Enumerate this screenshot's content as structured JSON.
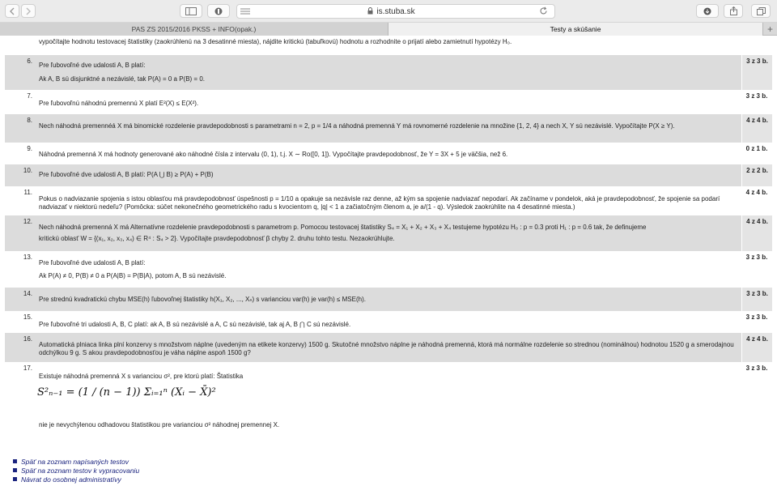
{
  "browser": {
    "url": "is.stuba.sk",
    "tabs": [
      "PAS ZS 2015/2016 PKSS + INFO(opak.)",
      "Testy a skúšanie"
    ]
  },
  "intro_text": "vypočítajte hodnotu testovacej štatistiky (zaokrúhlenú na 3 desatinné miesta), nájdite kritickú (tabuľkovú) hodnotu a rozhodnite o prijatí alebo zamietnutí hypotézy H₀.",
  "questions": [
    {
      "num": "6.",
      "score": "3 z 3 b.",
      "line1": "Pre ľubovoľné dve udalosti  A, B  platí:",
      "line2": "Ak A, B  sú disjunktné a nezávislé, tak  P(A) = 0  a  P(B) = 0."
    },
    {
      "num": "7.",
      "score": "3 z 3 b.",
      "line1": "Pre ľubovoľnú náhodnú premennú  X  platí  E²(X)  ≤  E(X²)."
    },
    {
      "num": "8.",
      "score": "4 z 4 b.",
      "line1": "Nech náhodná premennéá  X  má binomické rozdelenie pravdepodobnosti s parametrami  n = 2, p = 1/4  a  náhodná premenná  Y  má rovnomerné rozdelenie na množine  {1, 2, 4}  a nech  X, Y  sú nezávislé. Vypočítajte P(X ≥ Y)."
    },
    {
      "num": "9.",
      "score": "0 z 1 b.",
      "line1": "Náhodná premenná  X  má hodnoty generované ako náhodné čísla z intervalu  (0, 1), t.j.  X ∼ Ro([0,  1]). Vypočítajte pravdepodobnosť, že  Y = 3X + 5  je väčšia, než  6."
    },
    {
      "num": "10.",
      "score": "2 z 2 b.",
      "line1": "Pre ľubovoľné dve udalosti  A, B  platí:  P(A ⋃ B) ≥ P(A) + P(B)"
    },
    {
      "num": "11.",
      "score": "4 z 4 b.",
      "line1": "Pokus o nadviazanie spojenia s istou oblasťou má pravdepodobnosť úspešnosti  p = 1/10  a opakuje sa nezávisle raz denne, až kým sa spojenie nadviazať nepodarí. Ak začíname v pondelok, aká je pravdepodobnosť, že spojenie sa podarí nadviazať v niektorú nedeľu? (Pomôcka: súčet nekonečného geometrického radu s kvocientom  q, |q| < 1  a začiatočným členom  a, je  a/(1 - q). Výsledok zaokrúhlite na  4  desatinné miesta.)"
    },
    {
      "num": "12.",
      "score": "4 z 4 b.",
      "line1": "Nech náhodná premenná  X  má Alternatívne rozdelenie pravdepodobnosti s parametrom  p. Pomocou testovacej štatistiky  S₄  = X₁ + X₂ + X₃ + X₄  testujeme hypotézu  H₀ : p = 0.3  proti  H₁ : p = 0.6  tak, že definujeme",
      "line2": "kritickú oblasť  W = {(x₁, x₂, x₃, x₄) ∈ R⁴ : S₄ > 2}. Vypočítajte pravdepodobnosť  β  chyby 2. druhu tohto testu. Nezaokrúhlujte."
    },
    {
      "num": "13.",
      "score": "3 z 3 b.",
      "line1": "Pre ľubovoľné dve udalosti  A, B  platí:",
      "line2": "Ak  P(A) ≠ 0, P(B) ≠ 0  a  P(A|B) = P(B|A),  potom  A, B  sú nezávislé."
    },
    {
      "num": "14.",
      "score": "3 z 3 b.",
      "line1": "Pre strednú kvadratickú chybu  MSE(h)  ľubovoľnej štatistiky  h(X₁, X₂, ..., Xₙ)  s varianciou  var(h)  je  var(h) ≤ MSE(h)."
    },
    {
      "num": "15.",
      "score": "3 z 3 b.",
      "line1": "Pre ľubovoľné tri udalosti  A, B, C  platí:  ak  A, B  sú nezávislé a  A, C  sú nezávislé, tak aj  A, B ⋂ C sú nezávislé."
    },
    {
      "num": "16.",
      "score": "4 z 4 b.",
      "line1": "Automatická plniaca linka plní konzervy s množstvom náplne (uvedeným na etikete konzervy) 1500 g. Skutočné množstvo náplne je náhodná premenná, ktorá má normálne rozdelenie so strednou (nominálnou) hodnotou 1520 g a smerodajnou odchýlkou 9 g. S akou pravdepodobnosťou je váha náplne aspoň 1500 g?"
    },
    {
      "num": "17.",
      "score": "3 z 3 b.",
      "line1": "Existuje náhodná premenná  X  s varianciou  σ², pre ktorú  platí: Štatistika",
      "formula": "S²ₙ₋₁ = (1 / (n − 1)) Σᵢ₌₁ⁿ (Xᵢ − X̄)²",
      "line2": "nie je nevychýlenou odhadovou štatistikou pre varianciou  σ²  náhodnej premennej  X."
    }
  ],
  "links": [
    "Späť na zoznam napísaných testov",
    "Späť na zoznam testov k vypracovaniu",
    "Návrat do osobnej administratívy"
  ]
}
